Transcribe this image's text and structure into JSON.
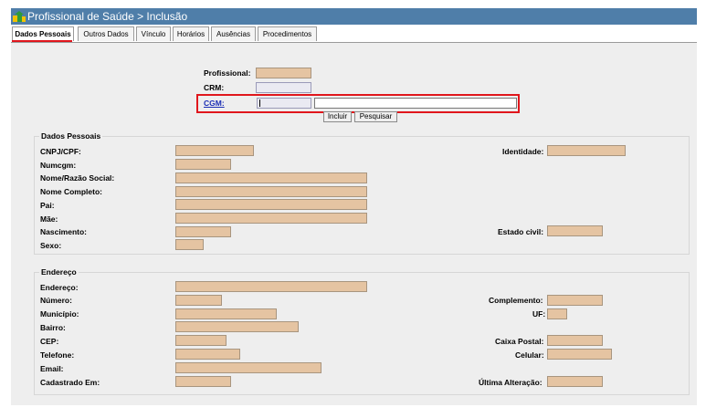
{
  "window": {
    "title": "Profissional de Saúde > Inclusão"
  },
  "tabs": [
    {
      "label": "Dados Pessoais"
    },
    {
      "label": "Outros Dados"
    },
    {
      "label": "Vínculo"
    },
    {
      "label": "Horários"
    },
    {
      "label": "Ausências"
    },
    {
      "label": "Procedimentos"
    }
  ],
  "top_form": {
    "profissional_label": "Profissional:",
    "crm_label": "CRM:",
    "cgm_label": "CGM:",
    "cgm_code_value": "",
    "cgm_name_value": "",
    "incluir_button": "Incluir",
    "pesquisar_button": "Pesquisar"
  },
  "dados_pessoais": {
    "legend": "Dados Pessoais",
    "cnpj_cpf": "CNPJ/CPF:",
    "numcgm": "Numcgm:",
    "nome_razao_social": "Nome/Razão Social:",
    "nome_completo": "Nome Completo:",
    "pai": "Pai:",
    "mae": "Mãe:",
    "nascimento": "Nascimento:",
    "sexo": "Sexo:",
    "identidade": "Identidade:",
    "estado_civil": "Estado civil:"
  },
  "endereco": {
    "legend": "Endereço",
    "endereco": "Endereço:",
    "numero": "Número:",
    "municipio": "Município:",
    "bairro": "Bairro:",
    "cep": "CEP:",
    "telefone": "Telefone:",
    "email": "Email:",
    "cadastrado_em": "Cadastrado Em:",
    "complemento": "Complemento:",
    "uf": "UF:",
    "caixa_postal": "Caixa Postal:",
    "celular": "Celular:",
    "ultima_alteracao": "Última Alteração:"
  },
  "colors": {
    "titlebar": "#4f7ea9",
    "readonly_field": "#e5c4a2",
    "highlight": "#e0161c",
    "link": "#1b2db5"
  }
}
